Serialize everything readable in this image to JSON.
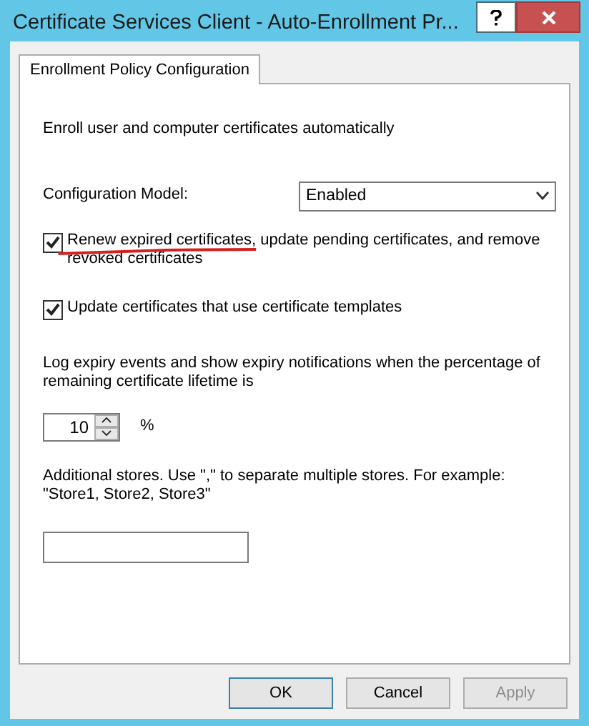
{
  "window": {
    "title": "Certificate Services Client - Auto-Enrollment Pr..."
  },
  "tabs": [
    {
      "label": "Enrollment Policy Configuration",
      "selected": true
    }
  ],
  "intro": "Enroll user and computer certificates automatically",
  "configuration_model": {
    "label": "Configuration Model:",
    "value": "Enabled"
  },
  "checkboxes": [
    {
      "label": "Renew expired certificates, update pending certificates, and remove revoked certificates",
      "checked": true,
      "annotated": true
    },
    {
      "label": "Update certificates that use certificate templates",
      "checked": true,
      "annotated": false
    }
  ],
  "expiry": {
    "text": "Log expiry events and show expiry notifications when the percentage of remaining certificate lifetime is",
    "value": "10",
    "unit": "%"
  },
  "stores": {
    "text": "Additional stores. Use \",\" to separate multiple stores. For example: \"Store1, Store2, Store3\""
  },
  "buttons": [
    {
      "label": "OK",
      "focused": true,
      "disabled": false
    },
    {
      "label": "Cancel",
      "focused": false,
      "disabled": false
    },
    {
      "label": "Apply",
      "focused": false,
      "disabled": true
    }
  ]
}
